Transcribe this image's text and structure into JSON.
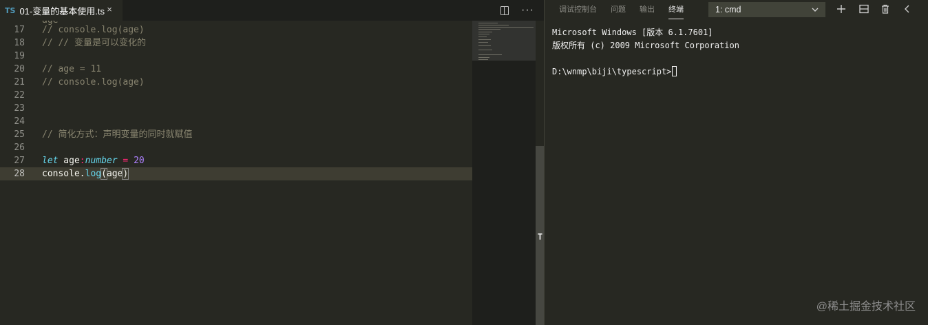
{
  "editor": {
    "tab": {
      "lang_badge": "TS",
      "title": "01-变量的基本使用.ts",
      "close": "×"
    },
    "actions": {
      "more": "···"
    },
    "ghost_top_text": "age",
    "lines": [
      {
        "num": "17",
        "text": "// console.log(age)"
      },
      {
        "num": "18",
        "text": "// // 变量是可以变化的"
      },
      {
        "num": "19",
        "text": ""
      },
      {
        "num": "20",
        "text": "// age = 11"
      },
      {
        "num": "21",
        "text": "// console.log(age)"
      },
      {
        "num": "22",
        "text": ""
      },
      {
        "num": "23",
        "text": ""
      },
      {
        "num": "24",
        "text": ""
      },
      {
        "num": "25",
        "text": "// 简化方式：声明变量的同时就赋值"
      },
      {
        "num": "26",
        "text": ""
      },
      {
        "num": "27",
        "tokens": {
          "kw": "let",
          "name": " age",
          "colon": ":",
          "type": "number",
          "eq": " = ",
          "num": "20"
        }
      },
      {
        "num": "28",
        "tokens": {
          "obj": "console",
          "dot": ".",
          "fn": "log",
          "lparen": "(",
          "arg": "age",
          "rparen": ")"
        }
      }
    ],
    "scroll_marker": "T"
  },
  "panel": {
    "tabs": [
      "调试控制台",
      "问题",
      "输出",
      "终端"
    ],
    "active_tab": "终端",
    "terminal_select": "1: cmd",
    "terminal_lines": [
      "Microsoft Windows [版本 6.1.7601]",
      "版权所有 (c) 2009 Microsoft Corporation",
      "",
      "D:\\wnmp\\biji\\typescript>"
    ]
  },
  "watermark": "@稀土掘金技术社区",
  "colors": {
    "background": "#272822",
    "comment": "#88846f",
    "keyword": "#66d9ef",
    "operator": "#f92672",
    "number": "#ae81ff",
    "ts_badge": "#519aba"
  }
}
